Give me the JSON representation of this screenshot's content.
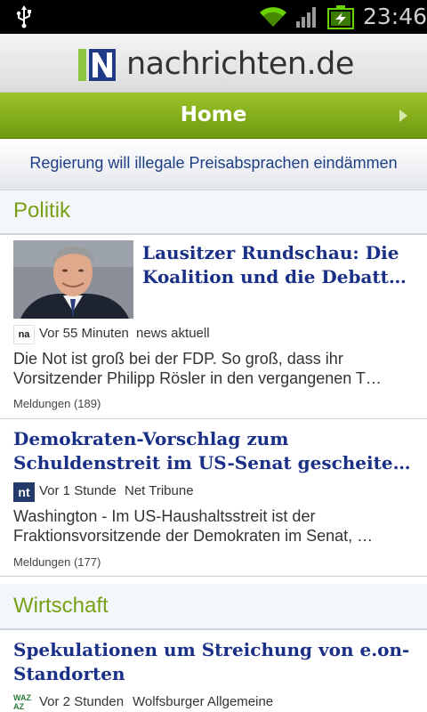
{
  "status_bar": {
    "time": "23:46",
    "icons": [
      "usb-icon",
      "wifi-icon",
      "signal-icon",
      "battery-charging-icon"
    ]
  },
  "header": {
    "logo_text": "nachrichten.de"
  },
  "nav": {
    "title": "Home",
    "next_icon": "chevron-right-icon"
  },
  "headline": {
    "text": "Regierung will illegale Preisabsprachen eindämmen"
  },
  "sections": [
    {
      "title": "Politik",
      "articles": [
        {
          "title_line1": "Lausitzer Rundschau: Die",
          "title_line2": "Koalition und die Debatt…",
          "source_logo": "na",
          "time": "Vor 55 Minuten",
          "source": "news aktuell",
          "summary_line1": "Die Not ist groß bei der FDP. So groß, dass ihr",
          "summary_line2": "Vorsitzender Philipp Rösler in den vergangenen T…",
          "count": "Meldungen (189)"
        },
        {
          "title_line1": "Demokraten-Vorschlag zum",
          "title_line2": "Schuldenstreit im US-Senat gescheite…",
          "source_logo": "nt",
          "time": "Vor 1 Stunde",
          "source": "Net Tribune",
          "summary_line1": "Washington - Im US-Haushaltsstreit ist der",
          "summary_line2": "Fraktionsvorsitzende der Demokraten im Senat, …",
          "count": "Meldungen (177)"
        }
      ]
    },
    {
      "title": "Wirtschaft",
      "articles": [
        {
          "title_line1": "Spekulationen um Streichung von e.on-",
          "title_line2": "Standorten",
          "source_logo": "WAZ AZ",
          "time": "Vor 2 Stunden",
          "source": "Wolfsburger Allgemeine"
        }
      ]
    }
  ],
  "colors": {
    "nav_green": "#8bb41f",
    "section_green": "#78a014",
    "title_blue": "#1a2f86",
    "headline_blue": "#1e3f86"
  }
}
